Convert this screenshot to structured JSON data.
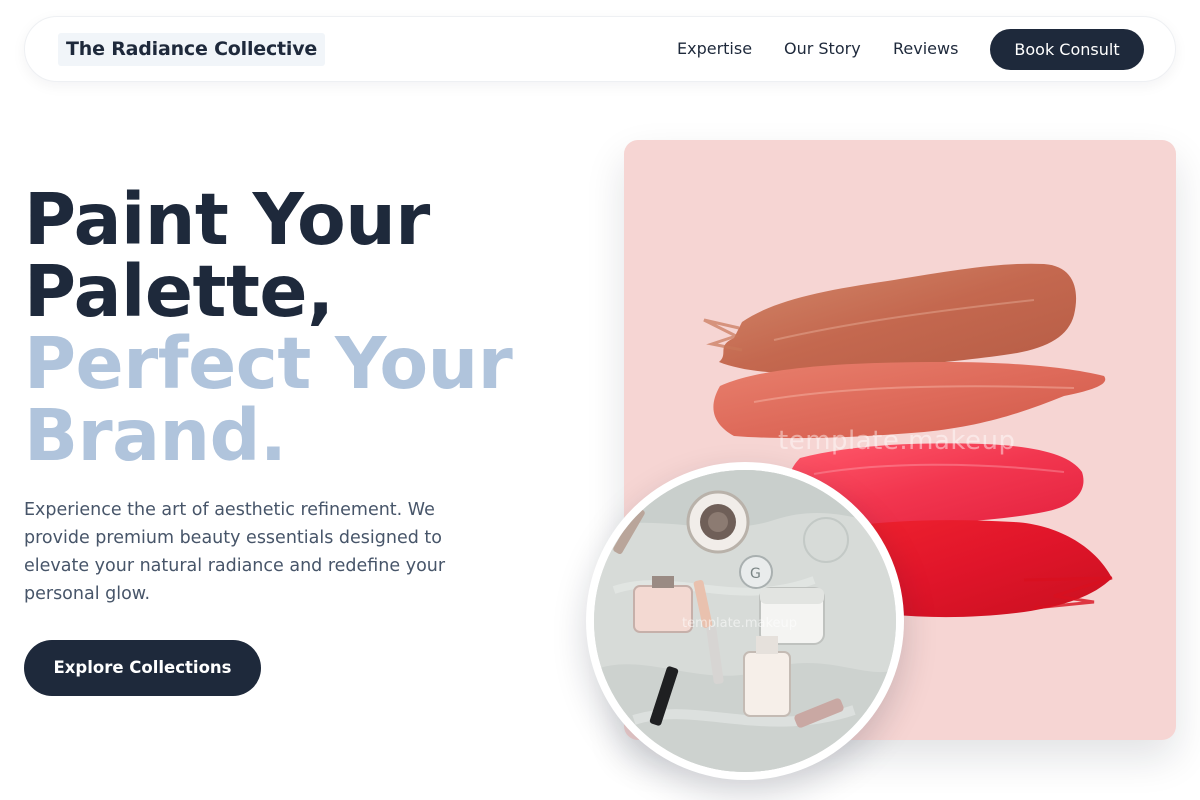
{
  "header": {
    "brand": "The Radiance Collective",
    "nav": [
      "Expertise",
      "Our Story",
      "Reviews"
    ],
    "cta_label": "Book Consult"
  },
  "hero": {
    "headline_line1": "Paint Your",
    "headline_line2": "Palette,",
    "headline_line3": "Perfect Your",
    "headline_line4": "Brand.",
    "lead": "Experience the art of aesthetic refinement. We provide premium beauty essentials designed to elevate your natural radiance and redefine your personal glow.",
    "cta_label": "Explore Collections"
  },
  "visual": {
    "watermark": "template.makeup",
    "inset_watermark": "template.makeup",
    "swatch_colors": [
      "#c4684f",
      "#de6a5a",
      "#f2364f",
      "#e0152a"
    ],
    "background": "#f6d5d3"
  },
  "colors": {
    "primary": "#1e293b",
    "accent_light": "#b0c4dc",
    "text_muted": "#475569"
  }
}
